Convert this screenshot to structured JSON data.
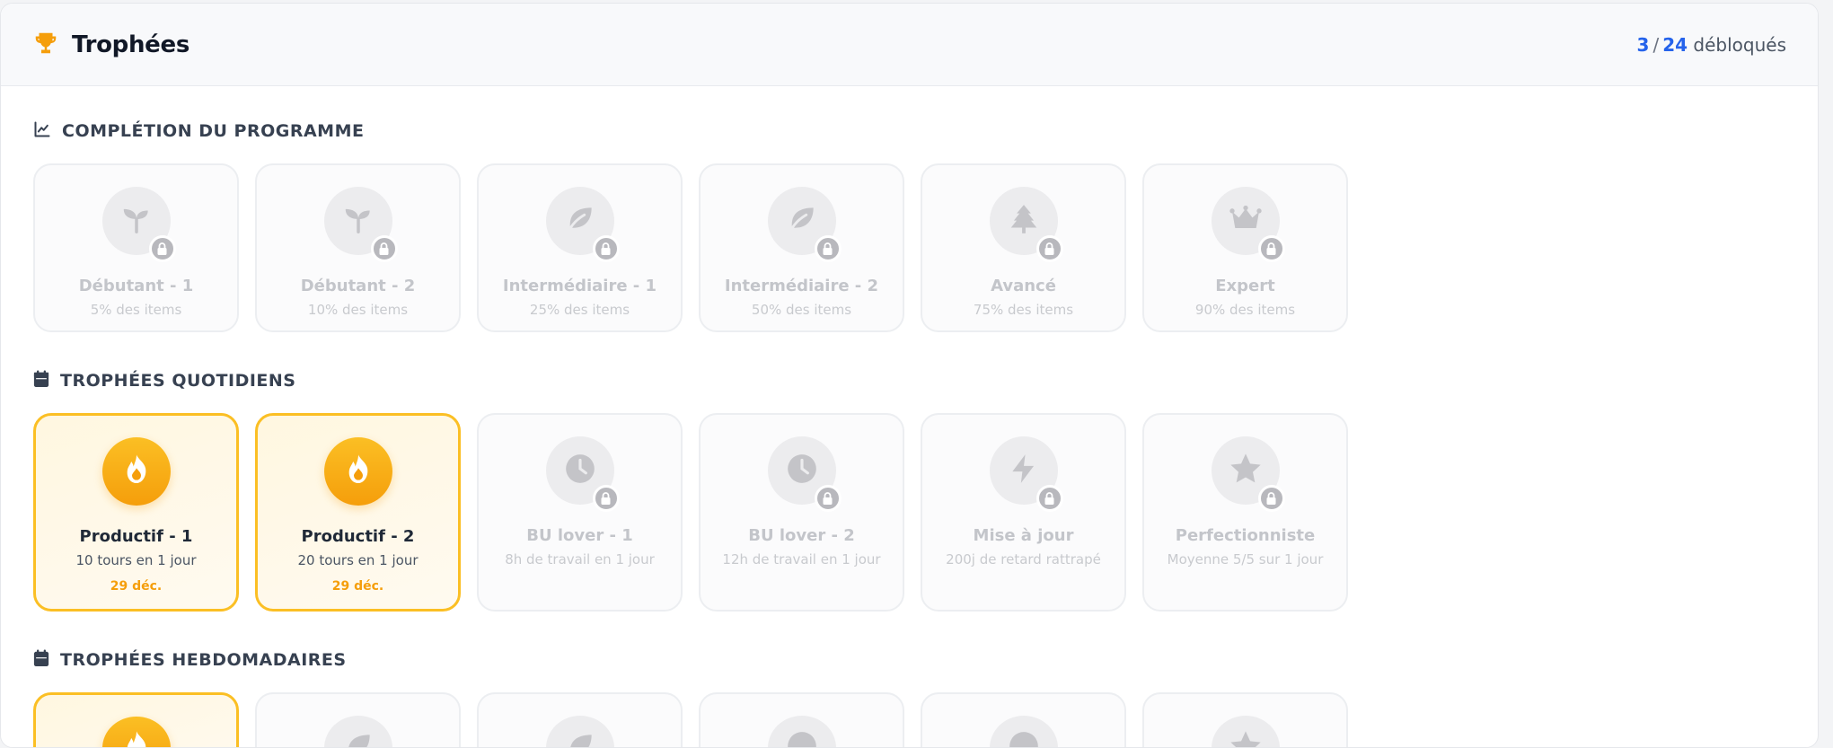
{
  "header": {
    "title": "Trophées",
    "unlocked_count": "3",
    "separator": "/",
    "total_count": "24",
    "suffix": "débloqués"
  },
  "colors": {
    "accent_gold": "#f59e0b",
    "accent_border": "#fbbf24",
    "count_blue": "#2563eb",
    "locked_gray": "#c3c5ca"
  },
  "sections": [
    {
      "title": "COMPLÉTION DU PROGRAMME",
      "icon": "chart-line-icon",
      "trophies": [
        {
          "title": "Débutant - 1",
          "desc": "5% des items",
          "icon": "sprout-icon",
          "unlocked": false
        },
        {
          "title": "Débutant - 2",
          "desc": "10% des items",
          "icon": "sprout-icon",
          "unlocked": false
        },
        {
          "title": "Intermédiaire - 1",
          "desc": "25% des items",
          "icon": "leaf-icon",
          "unlocked": false
        },
        {
          "title": "Intermédiaire - 2",
          "desc": "50% des items",
          "icon": "leaf-icon",
          "unlocked": false
        },
        {
          "title": "Avancé",
          "desc": "75% des items",
          "icon": "tree-icon",
          "unlocked": false
        },
        {
          "title": "Expert",
          "desc": "90% des items",
          "icon": "crown-icon",
          "unlocked": false
        }
      ]
    },
    {
      "title": "TROPHÉES QUOTIDIENS",
      "icon": "calendar-icon",
      "trophies": [
        {
          "title": "Productif - 1",
          "desc": "10 tours en 1 jour",
          "date": "29 déc.",
          "icon": "flame-icon",
          "unlocked": true
        },
        {
          "title": "Productif - 2",
          "desc": "20 tours en 1 jour",
          "date": "29 déc.",
          "icon": "flame-icon",
          "unlocked": true
        },
        {
          "title": "BU lover - 1",
          "desc": "8h de travail en 1 jour",
          "icon": "clock-icon",
          "unlocked": false
        },
        {
          "title": "BU lover - 2",
          "desc": "12h de travail en 1 jour",
          "icon": "clock-icon",
          "unlocked": false
        },
        {
          "title": "Mise à jour",
          "desc": "200j de retard rattrapé",
          "icon": "lightning-icon",
          "unlocked": false
        },
        {
          "title": "Perfectionniste",
          "desc": "Moyenne 5/5 sur 1 jour",
          "icon": "star-icon",
          "unlocked": false
        }
      ]
    },
    {
      "title": "TROPHÉES HEBDOMADAIRES",
      "icon": "calendar-icon",
      "trophies": [
        {
          "unlocked": true,
          "icon": "flame-icon"
        },
        {
          "unlocked": false,
          "icon": "leaf-icon"
        },
        {
          "unlocked": false,
          "icon": "leaf-icon"
        },
        {
          "unlocked": false,
          "icon": "clock-icon"
        },
        {
          "unlocked": false,
          "icon": "clock-icon"
        },
        {
          "unlocked": false,
          "icon": "star-icon"
        }
      ]
    }
  ]
}
